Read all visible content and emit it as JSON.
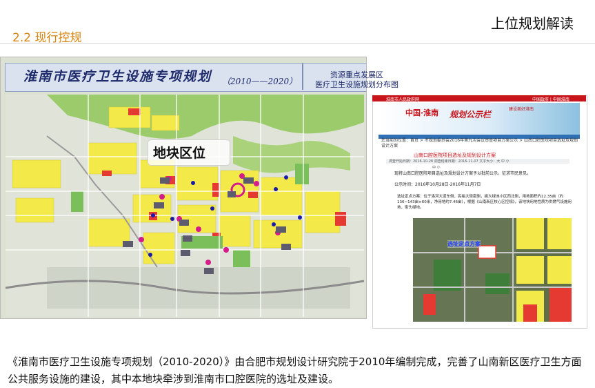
{
  "header": {
    "section": "2.2  现行控规",
    "title": "上位规划解读"
  },
  "left_map": {
    "title": "淮南市医疗卫生设施专项规划",
    "years": "（2010——2020）",
    "subtitle_line1": "资源重点发展区",
    "subtitle_line2": "医疗卫生设施规划分布图",
    "callout": "地块区位",
    "colors": {
      "residential": "#f3ea4a",
      "commercial": "#e53a32",
      "green": "#7bbf5a",
      "marker": "#d41d8a"
    }
  },
  "right_panel": {
    "top_left": "淮南市人民政府网",
    "top_right": "中国政府 | 中国淮南",
    "logo": "中国·淮南",
    "gongshi": "规划公示栏",
    "slogan": "建设美好淮南",
    "breadcrumb": "您当前的位置：首页 > 市规划委员会2016年第九次会议审查项目方案公示 > 山南口腔医院项目选址及规划设计方案",
    "notice_title": "山南口腔医院项目选址及规划设计方案",
    "info": "调查开始日期：2016-10-28  调查结束日期：2016-11-07  文字大小：大  中  小",
    "zoom": "中 小",
    "line1": "现将山南口腔医院项目选址及规划设计方案予以批前公示，征求市民意见。",
    "line2": "公示时间：2016年10月28日-2016年11月7日",
    "body": "选址定点方案：位于洛河大道东侧、民裕大街南侧，姚大绿洲小区西北侧，用地面积约12.35亩（约136~143亩×60米，净用地约7.46亩），根据《山南新区核心区控规》，该地块用地性质为供燃气设施用地，街头绿地。",
    "map_label": "选址定点方案"
  },
  "caption": "《淮南市医疗卫生设施专项规划（2010-2020）》由合肥市规划设计研究院于2010年编制完成，完善了山南新区医疗卫生方面公共服务设施的建设，其中本地块牵涉到淮南市口腔医院的选址及建设。"
}
